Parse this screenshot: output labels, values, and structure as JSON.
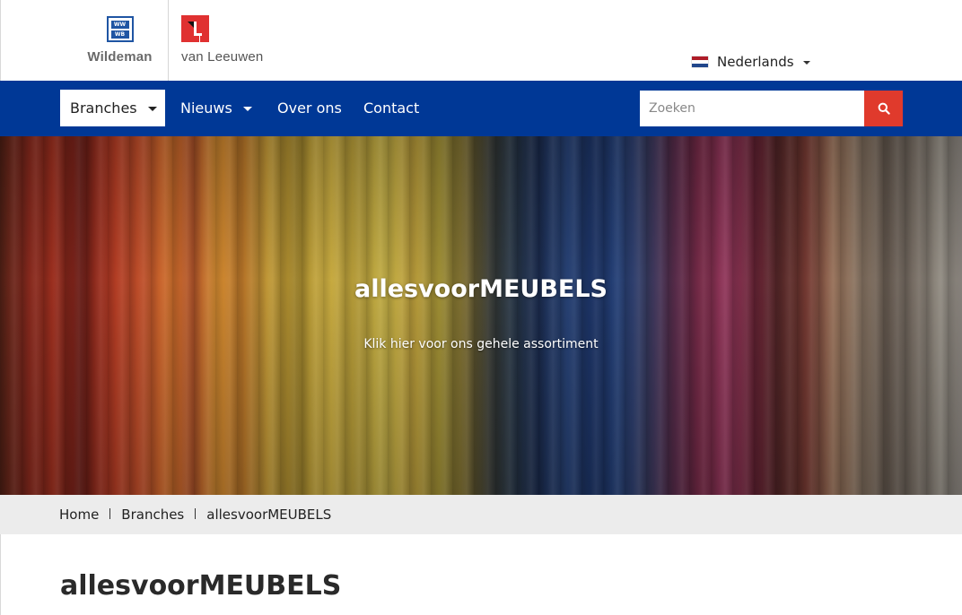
{
  "header": {
    "logo_left_text": "Wildeman",
    "logo_left_mark_top": "WW",
    "logo_left_mark_bottom": "WB",
    "logo_right_text": "van Leeuwen",
    "language": {
      "label": "Nederlands",
      "flag_colors": [
        "#ae1c28",
        "#ffffff",
        "#21468b"
      ]
    }
  },
  "nav": {
    "items": [
      {
        "label": "Branches",
        "has_dropdown": true,
        "active": true
      },
      {
        "label": "Nieuws",
        "has_dropdown": true,
        "active": false
      },
      {
        "label": "Over ons",
        "has_dropdown": false,
        "active": false
      },
      {
        "label": "Contact",
        "has_dropdown": false,
        "active": false
      }
    ],
    "search": {
      "placeholder": "Zoeken",
      "icon": "search-icon"
    }
  },
  "hero": {
    "title": "allesvoorMEUBELS",
    "link_text": "Klik hier voor ons gehele assortiment"
  },
  "breadcrumb": {
    "items": [
      "Home",
      "Branches",
      "allesvoorMEUBELS"
    ]
  },
  "main": {
    "page_title": "allesvoorMEUBELS"
  },
  "colors": {
    "nav_bg": "#003896",
    "search_button": "#e03a2c",
    "breadcrumb_bg": "#ececec",
    "logo_blue": "#1f55a3",
    "logo_red": "#e03131"
  }
}
